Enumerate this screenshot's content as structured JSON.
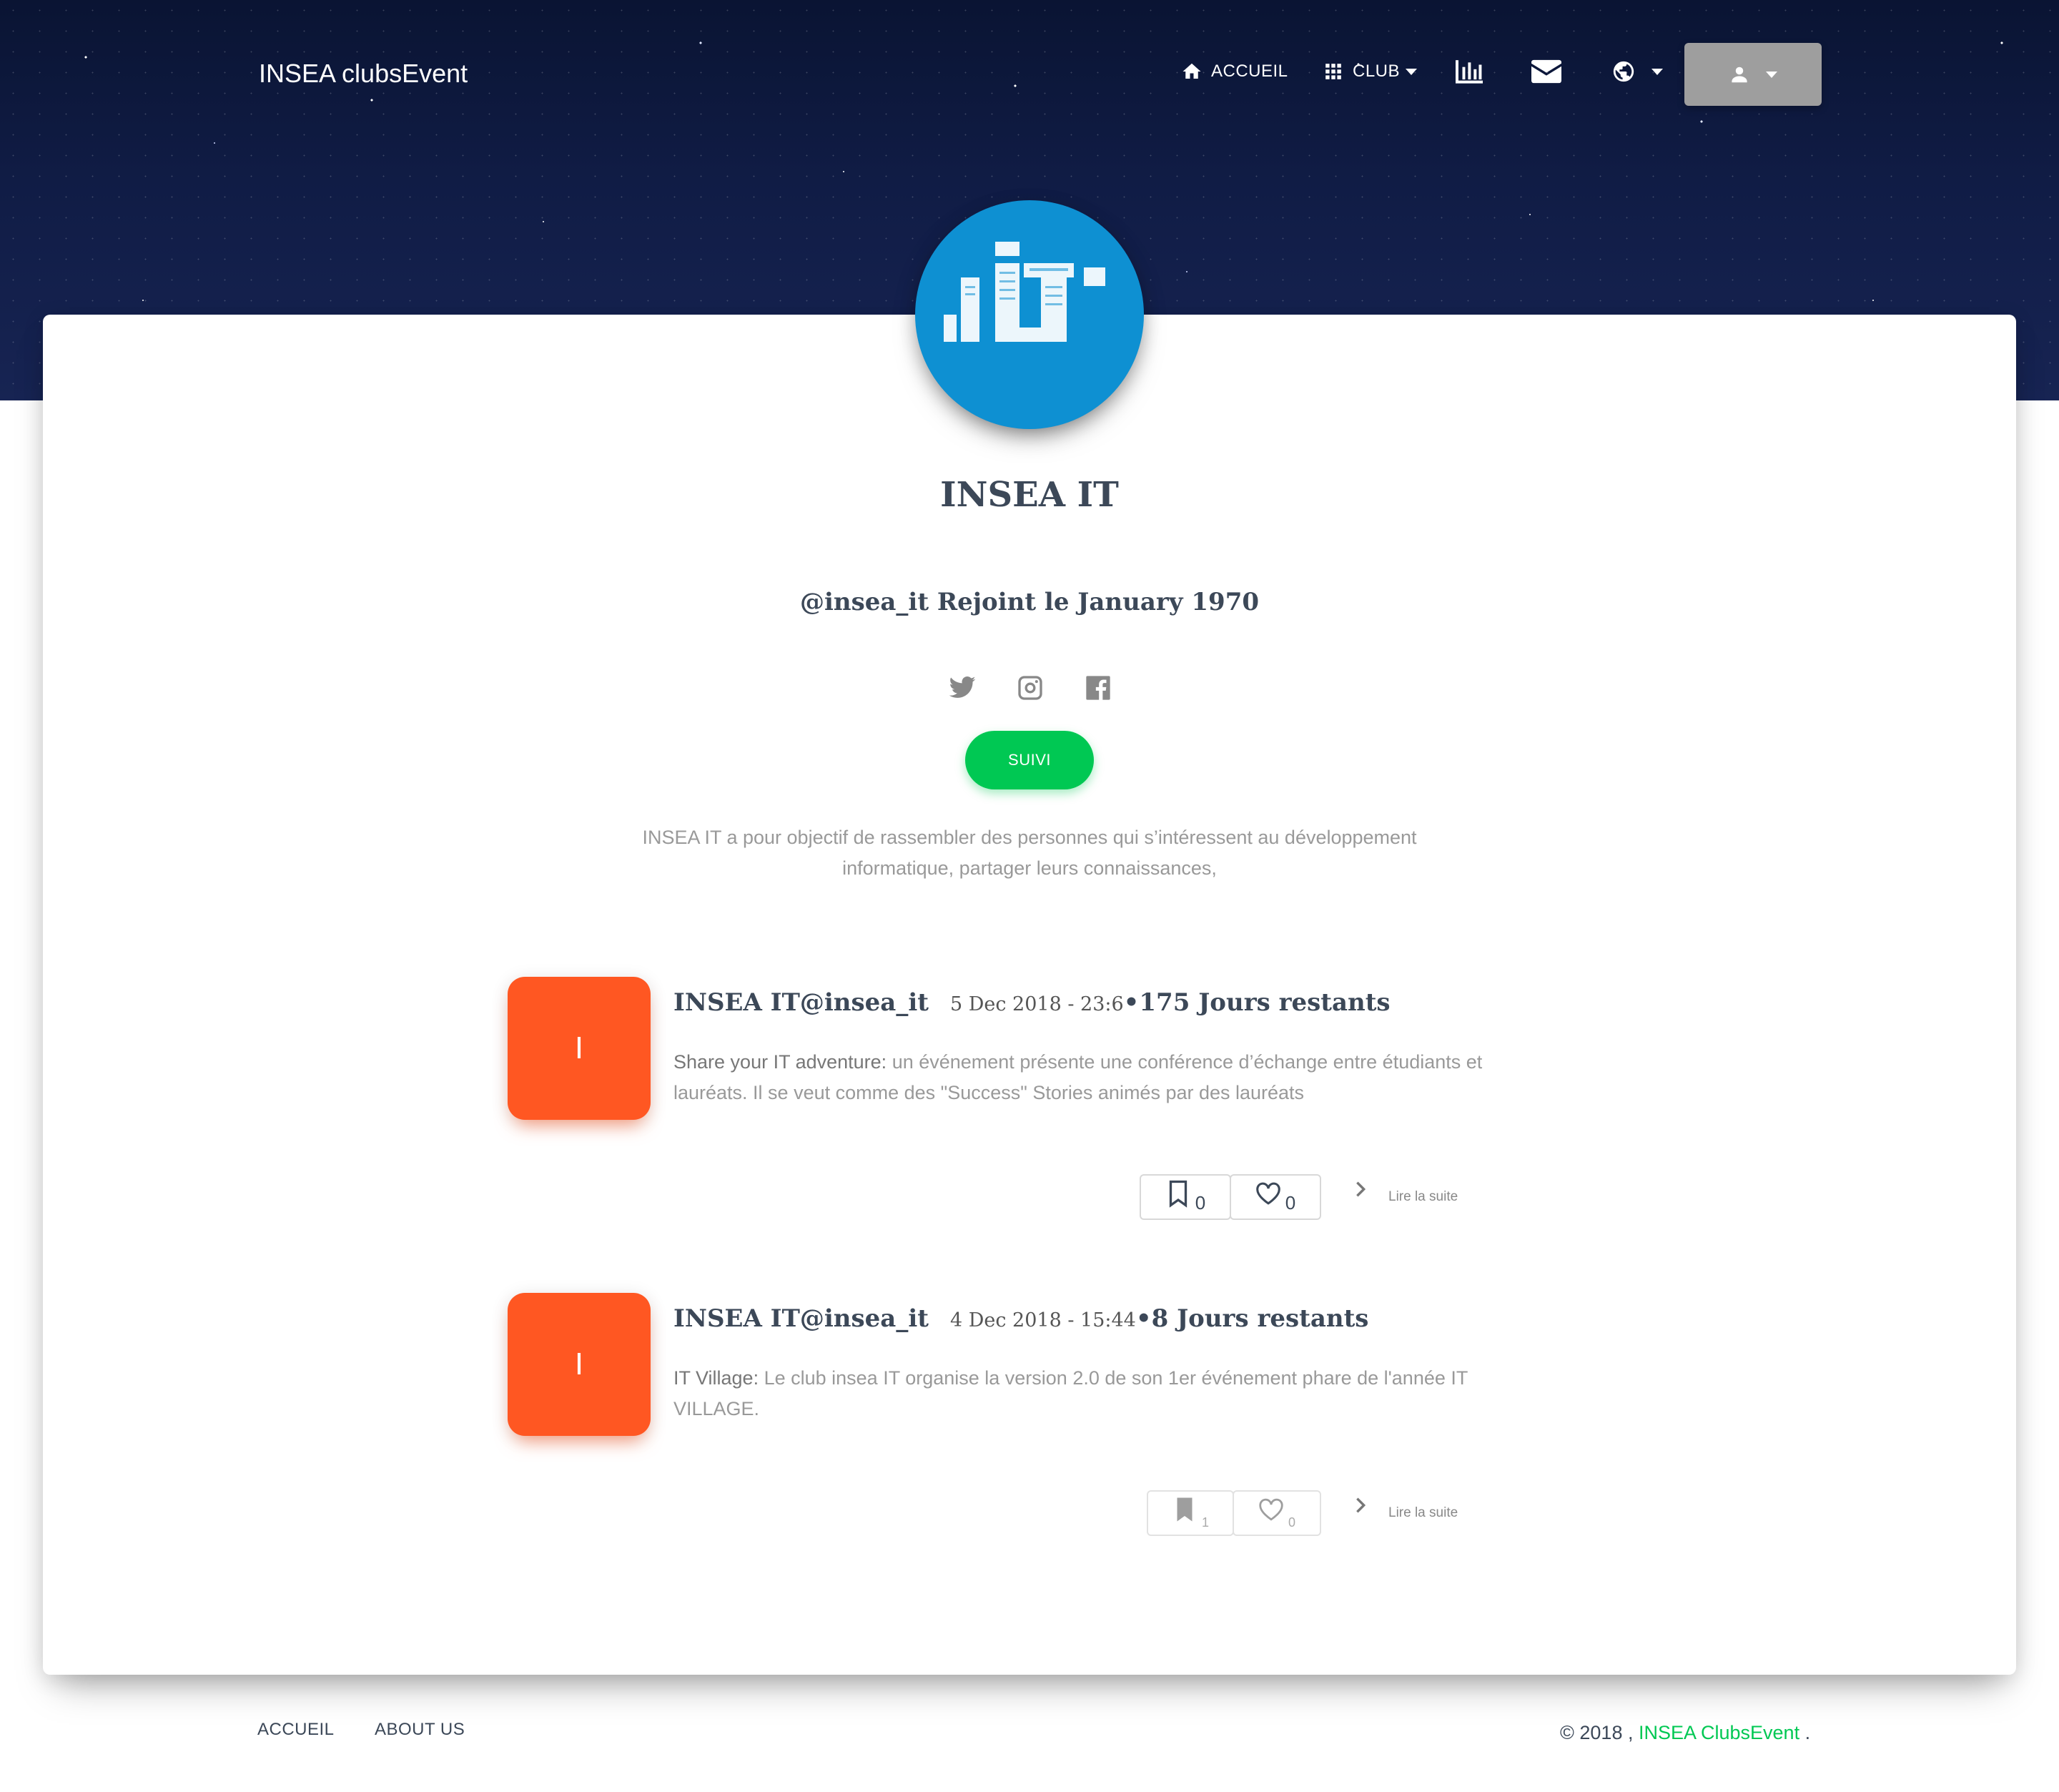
{
  "nav": {
    "brand": "INSEA clubsEvent",
    "home_label": "ACCUEIL",
    "club_label": "CLUB",
    "icons": [
      "home-icon",
      "apps-icon",
      "stats-icon",
      "mail-icon",
      "globe-icon",
      "user-icon"
    ]
  },
  "club": {
    "name": "INSEA IT",
    "joined": "@insea_it Rejoint le January 1970",
    "follow_label": "SUIVI",
    "description": "INSEA IT a pour objectif de rassembler des personnes qui s’intéressent au développement informatique, partager leurs connaissances,",
    "social_icons": [
      "twitter-icon",
      "instagram-icon",
      "facebook-icon"
    ]
  },
  "posts": [
    {
      "thumb_letter": "I",
      "author": "INSEA IT@insea_it",
      "date": "5 Dec 2018 - 23:6",
      "remaining": "•175 Jours restants",
      "lead": "Share your IT adventure:",
      "body": " un événement présente une conférence d’échange entre étudiants et lauréats. Il se veut comme des \"Success\" Stories animés par des lauréats",
      "bookmarks": "0",
      "likes": "0",
      "read_more": "Lire la suite"
    },
    {
      "thumb_letter": "I",
      "author": "INSEA IT@insea_it",
      "date": "4 Dec 2018 - 15:44",
      "remaining": "•8 Jours restants",
      "lead": "IT Village:",
      "body": " Le club insea IT organise la version 2.0 de son 1er événement phare de l'année IT VILLAGE.",
      "bookmarks": "1",
      "likes": "0",
      "read_more": "Lire la suite"
    }
  ],
  "footer": {
    "links": [
      "ACCUEIL",
      "ABOUT US"
    ],
    "copy_prefix": "© 2018 , ",
    "copy_brand": "INSEA ClubsEvent",
    "copy_suffix": " ."
  },
  "colors": {
    "accent_green": "#00c853",
    "post_thumb": "#ff5722",
    "avatar_blue": "#0e90d2",
    "user_button": "#9e9e9e"
  }
}
